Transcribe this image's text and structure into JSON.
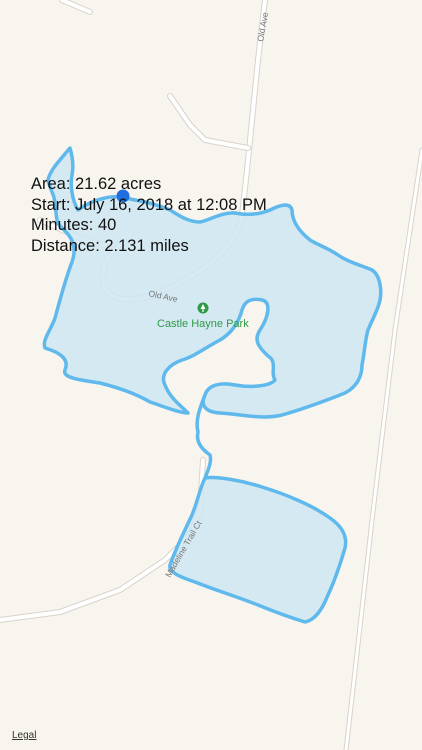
{
  "map": {
    "background_color": "#f8f4ee",
    "road_color": "#ffffff",
    "road_edge_color": "#d9d3cb",
    "area_fill_color": "#cfe6f2",
    "track_color": "#5fb9ec",
    "location_dot_color": "#1f6fe0",
    "labels": {
      "park_name": "Castle Hayne Park",
      "road_old_ave_top": "Old Ave",
      "road_old_ave_curve": "Old Ave",
      "road_madeline_trail": "Madeline Trail Ct"
    }
  },
  "stats": {
    "area": "Area: 21.62 acres",
    "start": "Start: July 16, 2018 at 12:08 PM",
    "minutes": "Minutes: 40",
    "distance": "Distance: 2.131 miles"
  },
  "footer": {
    "legal_link": "Legal"
  }
}
